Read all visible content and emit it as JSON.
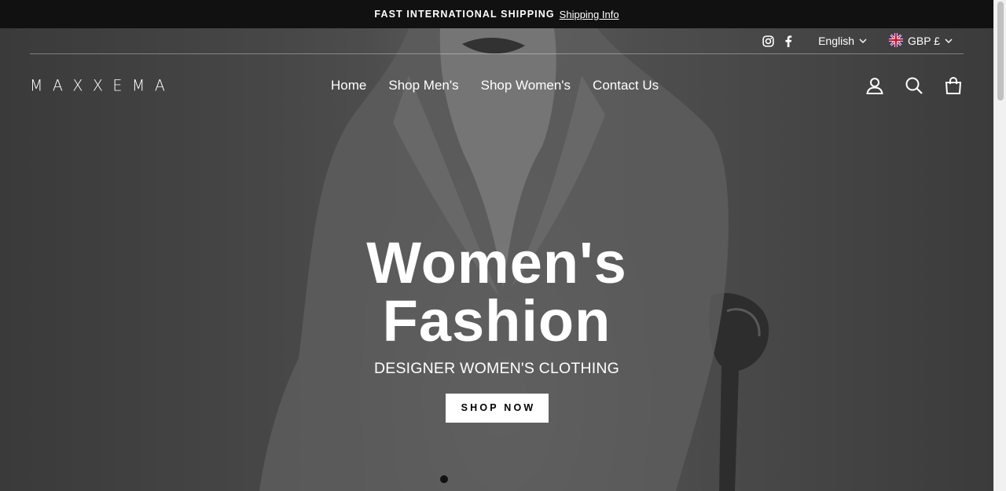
{
  "announcement": {
    "message": "FAST INTERNATIONAL SHIPPING",
    "link": "Shipping Info"
  },
  "utility": {
    "social": [
      "instagram-icon",
      "facebook-icon"
    ],
    "language": "English",
    "currency": "GBP £",
    "currency_flag": "uk-flag-icon"
  },
  "header": {
    "logo": "MAXXEMA",
    "nav": [
      "Home",
      "Shop Men's",
      "Shop Women's",
      "Contact Us"
    ],
    "icons": [
      "account-icon",
      "search-icon",
      "cart-icon"
    ]
  },
  "hero": {
    "title_line1": "Women's",
    "title_line2": "Fashion",
    "subtitle": "DESIGNER WOMEN'S CLOTHING",
    "cta": "SHOP NOW"
  },
  "colors": {
    "announcement_bg": "#111111",
    "text": "#ffffff",
    "cta_bg": "#ffffff",
    "cta_text": "#000000"
  }
}
